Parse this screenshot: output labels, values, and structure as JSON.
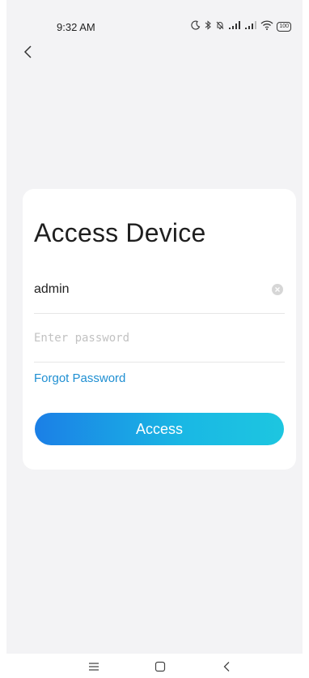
{
  "status_bar": {
    "time": "9:32 AM",
    "battery": "100",
    "icons": [
      "moon-icon",
      "bluetooth-icon",
      "mute-bell-icon",
      "signal-icon",
      "signal-icon",
      "wifi-icon",
      "battery-icon"
    ]
  },
  "nav": {
    "back_icon": "back-chevron-icon"
  },
  "card": {
    "title": "Access Device",
    "username": {
      "value": "admin"
    },
    "password": {
      "value": "",
      "placeholder": "Enter password"
    },
    "forgot_label": "Forgot Password",
    "access_label": "Access"
  },
  "system_nav": {
    "items": [
      "menu-icon",
      "home-icon",
      "back-icon"
    ]
  },
  "colors": {
    "accent_link": "#1f8fd2",
    "button_gradient_start": "#1b7fe6",
    "button_gradient_end": "#1dc6e0",
    "background": "#f3f3f5"
  }
}
